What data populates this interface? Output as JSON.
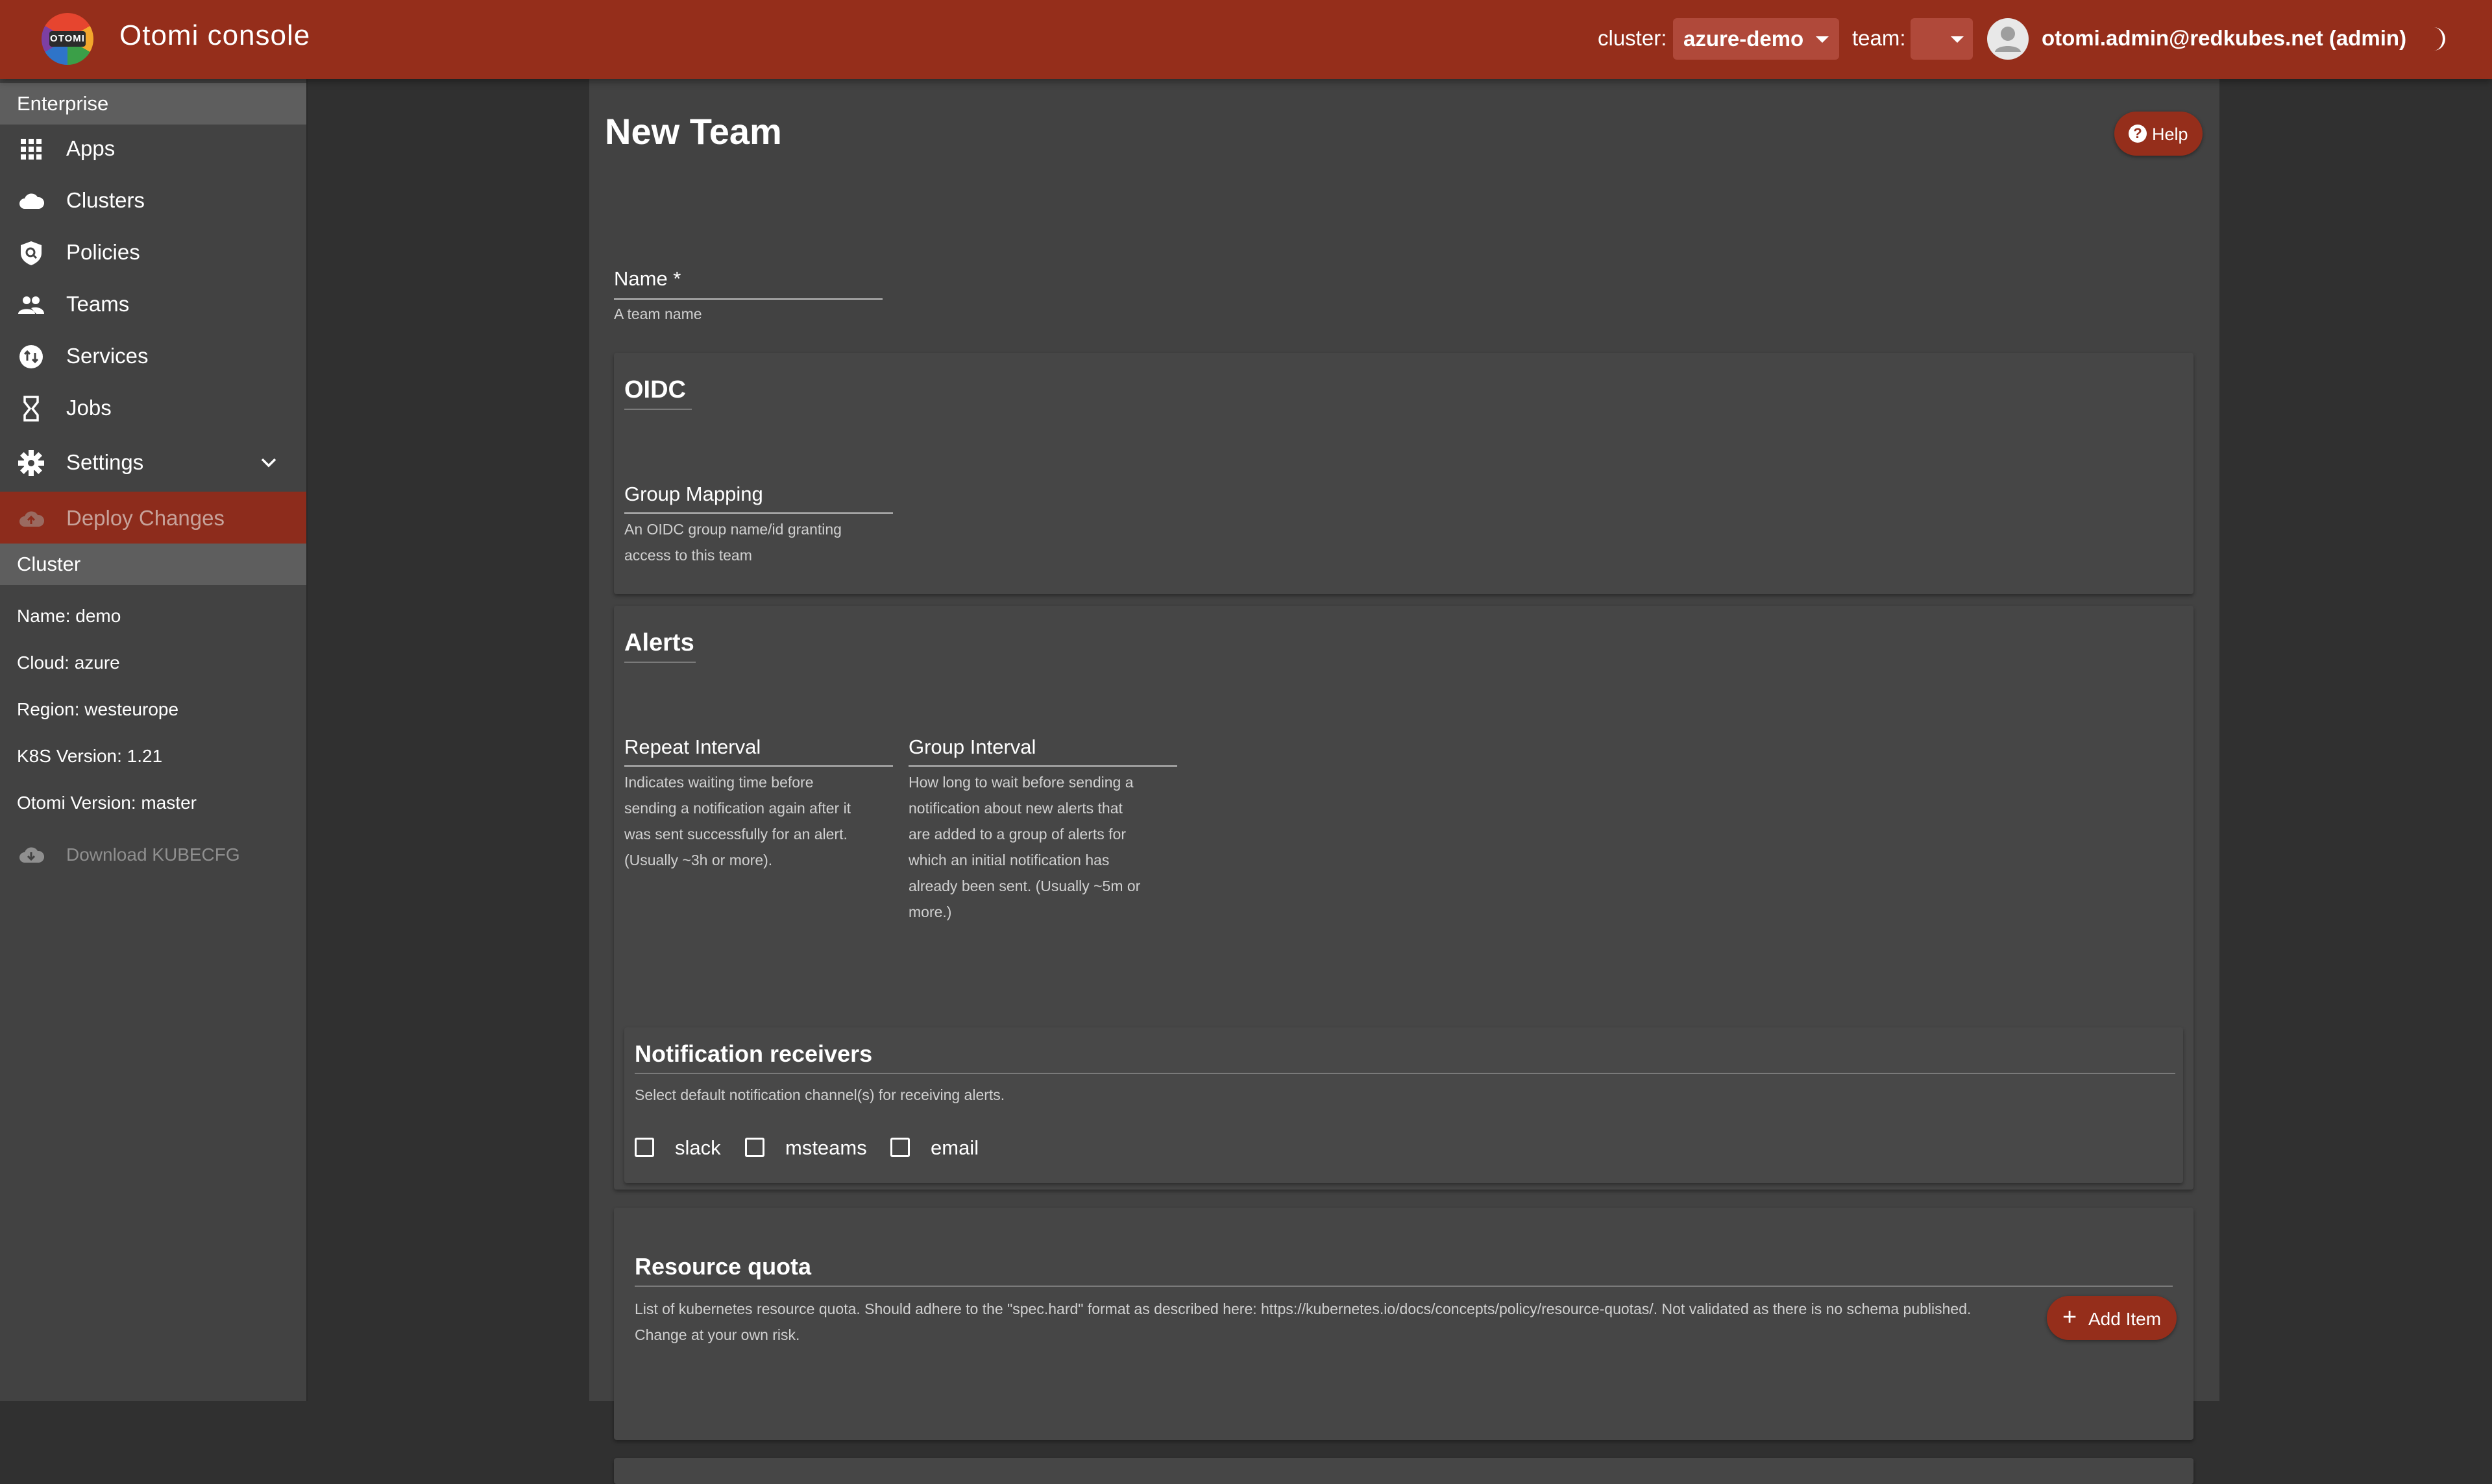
{
  "appbar": {
    "title": "Otomi console",
    "logo_text": "OTOMI",
    "cluster_label": "cluster:",
    "cluster_value": "azure-demo",
    "team_label": "team:",
    "team_value": "",
    "user": "otomi.admin@redkubes.net (admin)"
  },
  "sidebar": {
    "enterprise_header": "Enterprise",
    "items": [
      {
        "label": "Apps",
        "icon": "apps-grid-icon"
      },
      {
        "label": "Clusters",
        "icon": "cloud-icon"
      },
      {
        "label": "Policies",
        "icon": "policy-shield-icon"
      },
      {
        "label": "Teams",
        "icon": "people-icon"
      },
      {
        "label": "Services",
        "icon": "swap-icon"
      },
      {
        "label": "Jobs",
        "icon": "hourglass-icon"
      },
      {
        "label": "Settings",
        "icon": "gear-icon"
      }
    ],
    "deploy_label": "Deploy Changes",
    "cluster_header": "Cluster",
    "cluster_info": {
      "name": "Name: demo",
      "cloud": "Cloud: azure",
      "region": "Region: westeurope",
      "k8s": "K8S Version: 1.21",
      "otomi": "Otomi Version: master"
    },
    "download_label": "Download KUBECFG"
  },
  "form": {
    "page_title": "New Team",
    "help_label": "Help",
    "name_label": "Name *",
    "name_helper": "A team name",
    "oidc": {
      "title": "OIDC",
      "group_mapping_label": "Group Mapping",
      "group_mapping_helper_1": "An OIDC group name/id granting",
      "group_mapping_helper_2": "access to this team"
    },
    "alerts": {
      "title": "Alerts",
      "repeat_label": "Repeat Interval",
      "repeat_helper": [
        "Indicates waiting time before",
        "sending a notification again after it",
        "was sent successfully for an alert.",
        "(Usually ~3h or more)."
      ],
      "group_label": "Group Interval",
      "group_helper": [
        "How long to wait before sending a",
        "notification about new alerts that",
        "are added to a group of alerts for",
        "which an initial notification has",
        "already been sent. (Usually ~5m or",
        "more.)"
      ]
    },
    "receivers": {
      "title": "Notification receivers",
      "description": "Select default notification channel(s) for receiving alerts.",
      "options": [
        "slack",
        "msteams",
        "email"
      ]
    },
    "quota": {
      "title": "Resource quota",
      "description_1": "List of kubernetes resource quota. Should adhere to the \"spec.hard\" format as described here: https://kubernetes.io/docs/concepts/policy/resource-quotas/. Not validated as there is no schema published.",
      "description_2": "Change at your own risk.",
      "add_label": "Add Item"
    }
  }
}
